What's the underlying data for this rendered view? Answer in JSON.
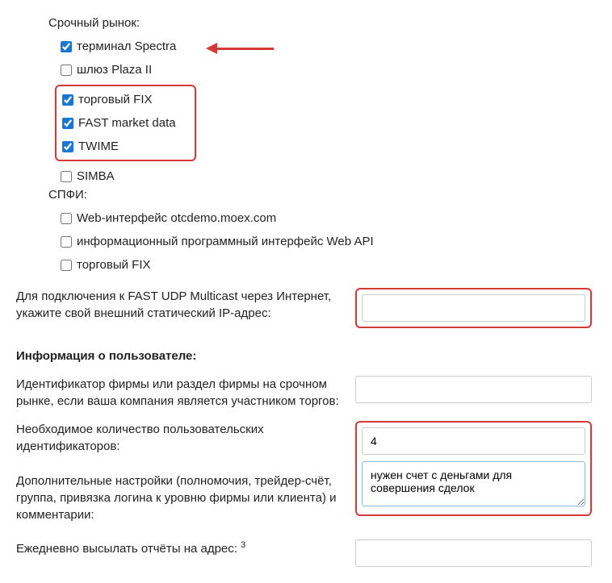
{
  "urgentMarket": {
    "title": "Срочный рынок:",
    "items": [
      {
        "label": "терминал Spectra",
        "checked": true
      },
      {
        "label": "шлюз Plaza II",
        "checked": false
      },
      {
        "label": "торговый FIX",
        "checked": true
      },
      {
        "label": "FAST market data",
        "checked": true
      },
      {
        "label": "TWIME",
        "checked": true
      },
      {
        "label": "SIMBA",
        "checked": false
      }
    ]
  },
  "spfi": {
    "title": "СПФИ:",
    "items": [
      {
        "label": "Web-интерфейс otcdemo.moex.com",
        "checked": false
      },
      {
        "label": "информационный программный интерфейс Web API",
        "checked": false
      },
      {
        "label": "торговый FIX",
        "checked": false
      }
    ]
  },
  "fastUdp": {
    "label": "Для подключения к FAST UDP Multicast через Интернет, укажите свой внешний статический IP-адрес:",
    "value": ""
  },
  "userInfo": {
    "heading": "Информация о пользователе:",
    "firmId": {
      "label": "Идентификатор фирмы или раздел фирмы на срочном рынке, если ваша компания является участником торгов:",
      "value": ""
    },
    "idCount": {
      "label": "Необходимое количество пользовательских идентификаторов:",
      "value": "4"
    },
    "extra": {
      "label": "Дополнительные настройки (полномочия, трейдер-счёт, группа, привязка логина к уровню фирмы или клиента) и комментарии:",
      "value": "нужен счет с деньгами для совершения сделок"
    },
    "reports": {
      "label": "Ежедневно высылать отчёты на адрес: ",
      "sup": "3",
      "value": ""
    }
  }
}
